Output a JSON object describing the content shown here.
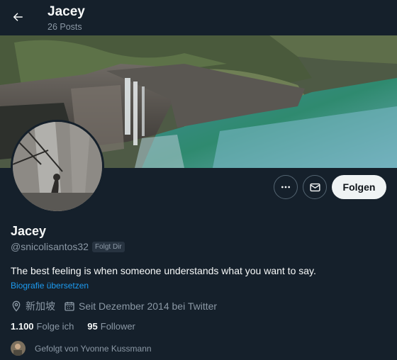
{
  "header": {
    "title": "Jacey",
    "posts_count": "26 Posts",
    "back_icon": "arrow-left-icon"
  },
  "profile": {
    "display_name": "Jacey",
    "handle": "@snicolisantos32",
    "follows_you": "Folgt Dir",
    "bio": "The best feeling is when someone understands what you want to say.",
    "translate_link": "Biografie übersetzen",
    "location": "新加坡",
    "joined": "Seit Dezember 2014 bei Twitter"
  },
  "actions": {
    "more_icon": "more-horizontal-icon",
    "message_icon": "envelope-icon",
    "follow_label": "Folgen"
  },
  "stats": {
    "following_count": "1.100",
    "following_label": "Folge ich",
    "followers_count": "95",
    "followers_label": "Follower"
  },
  "followed_by": {
    "text": "Gefolgt von Yvonne Kussmann"
  },
  "colors": {
    "background": "#15202b",
    "text_primary": "#f7f9f9",
    "text_secondary": "#8b98a5",
    "link": "#1d9bf0",
    "button_bg": "#eff3f4"
  }
}
